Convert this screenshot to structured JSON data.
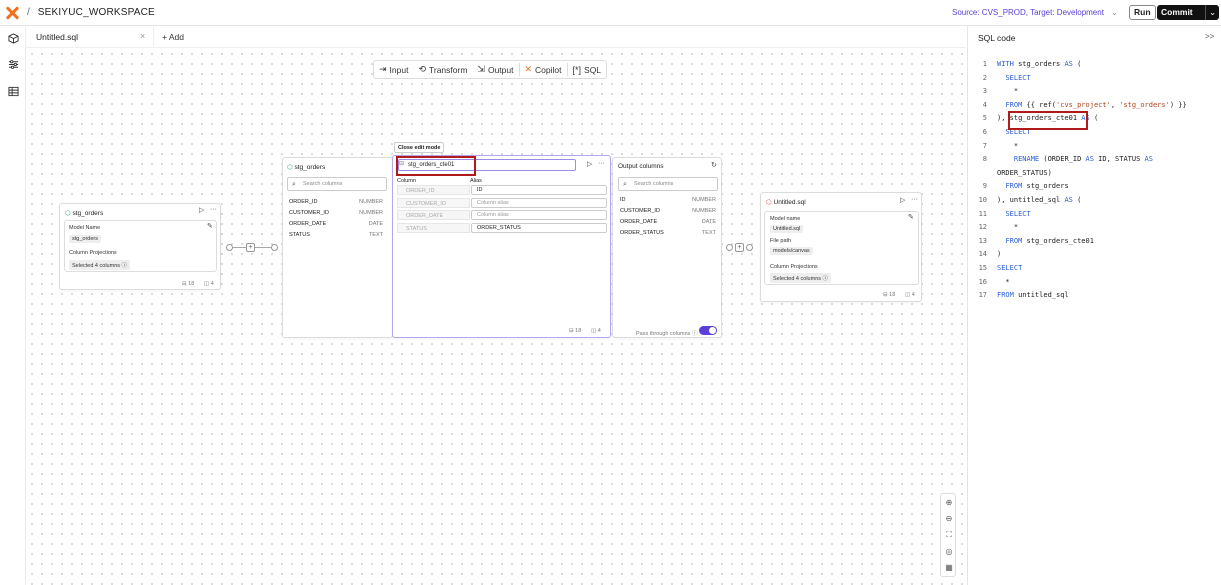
{
  "header": {
    "separator": "/",
    "workspace": "SEKIYUC_WORKSPACE",
    "environment": "Source: CVS_PROD, Target: Development",
    "env_chevron": "⌄",
    "run_label": "Run",
    "commit_label": "Commit",
    "commit_chevron": "⌄"
  },
  "tabs": {
    "active": "Untitled.sql",
    "close": "×",
    "add_label": "+  Add"
  },
  "toolbar": {
    "input": "Input",
    "transform": "Transform",
    "output": "Output",
    "copilot": "Copilot",
    "sql": "SQL"
  },
  "source_node": {
    "title": "stg_orders",
    "model_name_label": "Model Name",
    "model_name": "stg_orders",
    "projections_label": "Column Projections",
    "projections_value": "Selected 4 columns ⓘ",
    "footer_rows": "⊟ 18",
    "footer_cols": "◫ 4"
  },
  "input_node": {
    "title": "stg_orders",
    "search_placeholder": "Search columns",
    "columns": [
      {
        "name": "ORDER_ID",
        "type": "NUMBER"
      },
      {
        "name": "CUSTOMER_ID",
        "type": "NUMBER"
      },
      {
        "name": "ORDER_DATE",
        "type": "DATE"
      },
      {
        "name": "STATUS",
        "type": "TEXT"
      }
    ]
  },
  "edit_node": {
    "tooltip": "Close edit mode",
    "name_value": "stg_orders_cte01",
    "column_header": "Column",
    "alias_header": "Alias",
    "rows": [
      {
        "column": "ORDER_ID",
        "alias": "ID"
      },
      {
        "column": "CUSTOMER_ID",
        "alias": "Column alias"
      },
      {
        "column": "ORDER_DATE",
        "alias": "Column alias"
      },
      {
        "column": "STATUS",
        "alias": "ORDER_STATUS"
      }
    ],
    "footer_rows": "⊟ 18",
    "footer_cols": "◫ 4"
  },
  "output_node": {
    "title": "Output columns",
    "search_placeholder": "Search columns",
    "columns": [
      {
        "name": "ID",
        "type": "NUMBER"
      },
      {
        "name": "CUSTOMER_ID",
        "type": "NUMBER"
      },
      {
        "name": "ORDER_DATE",
        "type": "DATE"
      },
      {
        "name": "ORDER_STATUS",
        "type": "TEXT"
      }
    ],
    "pass_through_label": "Pass through columns ⓘ",
    "pass_through_on": true
  },
  "target_node": {
    "title": "Untitled.sql",
    "model_name_label": "Model name",
    "model_name": "Untitled.sql",
    "file_path_label": "File path",
    "file_path": "models/canvas",
    "projections_label": "Column Projections",
    "projections_value": "Selected 4 columns ⓘ",
    "footer_rows": "⊟ 18",
    "footer_cols": "◫ 4"
  },
  "sql_panel": {
    "title": "SQL code",
    "collapse": ">>",
    "lines": [
      {
        "n": "1",
        "text": "WITH stg_orders AS ("
      },
      {
        "n": "2",
        "text": "  SELECT"
      },
      {
        "n": "3",
        "text": "    *"
      },
      {
        "n": "4",
        "text": "  FROM {{ ref('cvs_project', 'stg_orders') }}"
      },
      {
        "n": "5",
        "text": "), stg_orders_cte01 AS ("
      },
      {
        "n": "6",
        "text": "  SELECT"
      },
      {
        "n": "7",
        "text": "    *"
      },
      {
        "n": "8",
        "text": "    RENAME (ORDER_ID AS ID, STATUS AS"
      },
      {
        "n": "",
        "text": "ORDER_STATUS)"
      },
      {
        "n": "9",
        "text": "  FROM stg_orders"
      },
      {
        "n": "10",
        "text": "), untitled_sql AS ("
      },
      {
        "n": "11",
        "text": "  SELECT"
      },
      {
        "n": "12",
        "text": "    *"
      },
      {
        "n": "13",
        "text": "  FROM stg_orders_cte01"
      },
      {
        "n": "14",
        "text": ")"
      },
      {
        "n": "15",
        "text": "SELECT"
      },
      {
        "n": "16",
        "text": "  *"
      },
      {
        "n": "17",
        "text": "FROM untitled_sql"
      }
    ]
  },
  "icons": {
    "play": "▷",
    "more": "···",
    "pencil": "✎",
    "refresh": "↻",
    "plus": "+",
    "zoom_in": "⊕",
    "zoom_out": "⊖",
    "fit": "⛶",
    "center": "◎",
    "grid": "▦"
  },
  "colors": {
    "accent": "#5b3fd6",
    "highlight": "#b11a1a",
    "logo": "#f0701d"
  }
}
